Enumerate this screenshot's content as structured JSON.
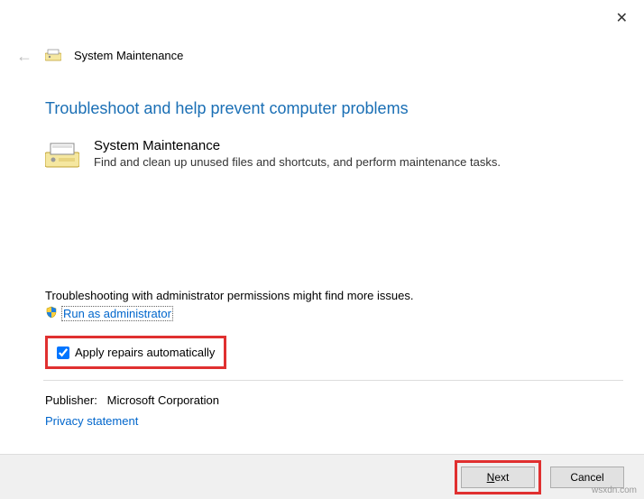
{
  "close_label": "✕",
  "back_arrow": "←",
  "window_title": "System Maintenance",
  "heading": "Troubleshoot and help prevent computer problems",
  "troubleshooter": {
    "name": "System Maintenance",
    "description": "Find and clean up unused files and shortcuts, and perform maintenance tasks."
  },
  "admin_note": "Troubleshooting with administrator permissions might find more issues.",
  "admin_link": "Run as administrator",
  "apply_repairs": {
    "label": "Apply repairs automatically",
    "checked": true
  },
  "publisher_label": "Publisher:",
  "publisher_value": "Microsoft Corporation",
  "privacy_link": "Privacy statement",
  "buttons": {
    "next_key": "N",
    "next_rest": "ext",
    "cancel": "Cancel"
  },
  "watermark": "wsxdn.com"
}
